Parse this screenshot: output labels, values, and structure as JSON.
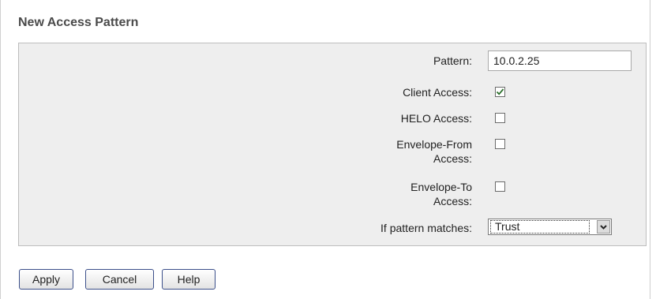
{
  "form": {
    "title": "New Access Pattern",
    "pattern_label": "Pattern:",
    "pattern_value": "10.0.2.25",
    "client_access_label": "Client Access:",
    "client_access_checked": true,
    "helo_access_label": "HELO Access:",
    "helo_access_checked": false,
    "envelope_from_label_line1": "Envelope-From",
    "envelope_from_label_line2": "Access:",
    "envelope_from_checked": false,
    "envelope_to_label_line1": "Envelope-To",
    "envelope_to_label_line2": "Access:",
    "envelope_to_checked": false,
    "if_match_label": "If pattern matches:",
    "if_match_value": "Trust"
  },
  "buttons": {
    "apply": "Apply",
    "cancel": "Cancel",
    "help": "Help"
  },
  "colors": {
    "panel_bg": "#eeeeee",
    "check_mark": "#2a6e2a",
    "button_border": "#3b4f8a"
  },
  "icons": {
    "checkmark": "check-icon",
    "dropdown": "chevron-down-icon"
  }
}
